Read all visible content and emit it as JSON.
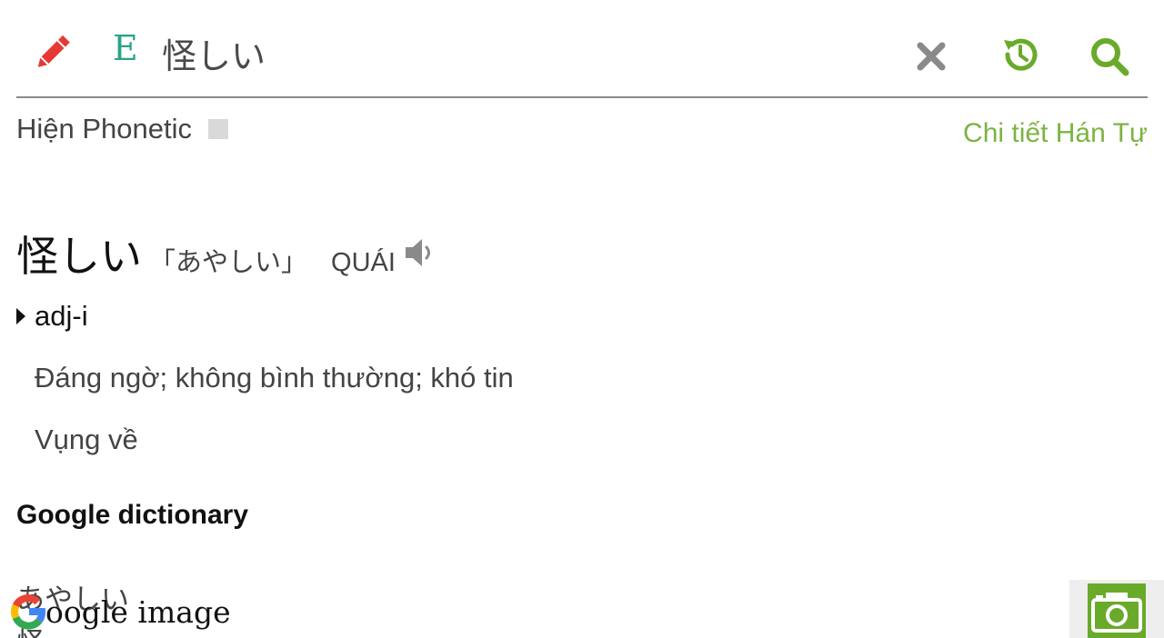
{
  "header": {
    "edit_icon": "pencil-icon",
    "lang_toggle": "E",
    "search_value": "怪しい",
    "clear_icon": "close-icon",
    "history_icon": "history-icon",
    "search_icon": "search-icon"
  },
  "options": {
    "phonetic_label": "Hiện Phonetic",
    "phonetic_checked": false,
    "kanji_detail_link": "Chi tiết Hán Tự"
  },
  "entry": {
    "word": "怪しい",
    "reading": "「あやしい」",
    "hanviet": "QUÁI",
    "speaker_icon": "speaker-icon",
    "part_of_speech": "adj-i",
    "meanings": [
      "Đáng ngờ; không bình thường; khó tin",
      "Vụng về"
    ]
  },
  "google": {
    "section_title": "Google dictionary",
    "reading": "あやしい",
    "kanji": "怪"
  },
  "bottom": {
    "google_image_label": "oogle image",
    "camera_icon": "camera-icon"
  },
  "colors": {
    "accent_green": "#7cb342",
    "icon_green": "#6aaa2a",
    "edit_red": "#e53935",
    "lang_teal": "#2aa388",
    "clear_gray": "#8a8a8a"
  }
}
